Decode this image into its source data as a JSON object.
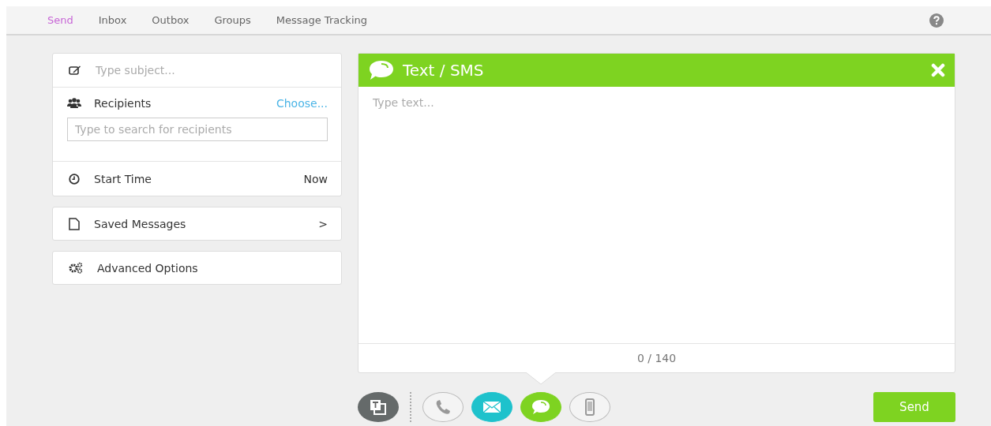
{
  "nav": {
    "tabs": [
      {
        "label": "Send",
        "selected": true
      },
      {
        "label": "Inbox",
        "selected": false
      },
      {
        "label": "Outbox",
        "selected": false
      },
      {
        "label": "Groups",
        "selected": false
      },
      {
        "label": "Message Tracking",
        "selected": false
      }
    ]
  },
  "compose": {
    "subject_placeholder": "Type subject...",
    "recipients": {
      "label": "Recipients",
      "action": "Choose...",
      "search_placeholder": "Type to search for recipients"
    },
    "start_time": {
      "label": "Start Time",
      "value": "Now"
    }
  },
  "saved_messages": {
    "label": "Saved Messages",
    "chevron": ">"
  },
  "advanced_options": {
    "label": "Advanced Options"
  },
  "editor": {
    "title": "Text / SMS",
    "placeholder": "Type text...",
    "counter": "0 / 140"
  },
  "channels": [
    {
      "kind": "voice",
      "on": false
    },
    {
      "kind": "email",
      "on": true,
      "color": "#1ec2cc"
    },
    {
      "kind": "sms",
      "on": true,
      "color": "#7ed321"
    },
    {
      "kind": "app",
      "on": false
    }
  ],
  "send_button": "Send"
}
